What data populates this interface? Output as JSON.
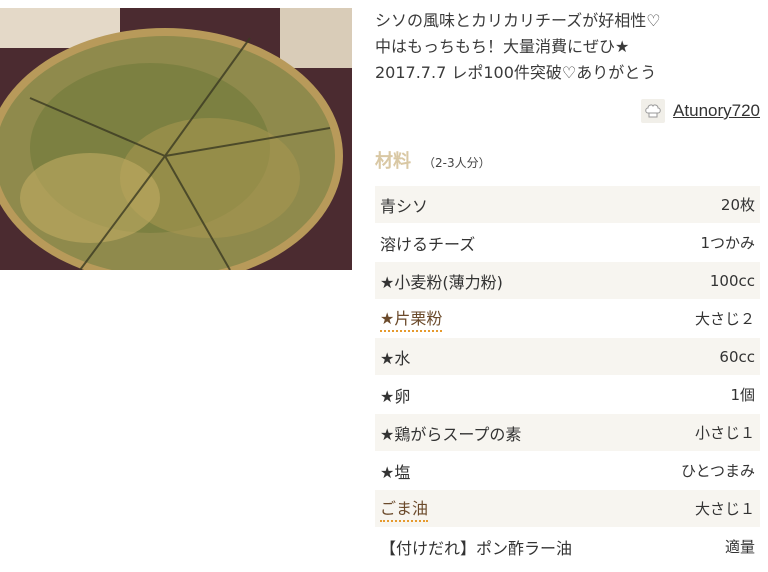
{
  "recipe": {
    "description_lines": [
      "シソの風味とカリカリチーズが好相性♡",
      "中はもっちもち！大量消費にぜひ★",
      "2017.7.7 レポ100件突破♡ありがとう"
    ],
    "author": "Atunory720",
    "author_icon": "chef-hat-icon"
  },
  "ingredients": {
    "title": "材料",
    "servings": "（2-3人分）",
    "items": [
      {
        "name": "青シソ",
        "qty": "20枚",
        "link": false
      },
      {
        "name": "溶けるチーズ",
        "qty": "1つかみ",
        "link": false
      },
      {
        "name": "★小麦粉(薄力粉)",
        "qty": "100cc",
        "link": false
      },
      {
        "name": "★片栗粉",
        "qty": "大さじ２",
        "link": true
      },
      {
        "name": "★水",
        "qty": "60cc",
        "link": false
      },
      {
        "name": "★卵",
        "qty": "1個",
        "link": false
      },
      {
        "name": "★鶏がらスープの素",
        "qty": "小さじ１",
        "link": false
      },
      {
        "name": "★塩",
        "qty": "ひとつまみ",
        "link": false
      },
      {
        "name": "ごま油",
        "qty": "大さじ１",
        "link": true
      },
      {
        "name": "【付けだれ】ポン酢ラー油",
        "qty": "適量",
        "link": false
      }
    ]
  },
  "colors": {
    "accent_title": "#d9c8a4",
    "link_underline": "#e69a2e",
    "row_stripe": "#f7f5f0"
  }
}
